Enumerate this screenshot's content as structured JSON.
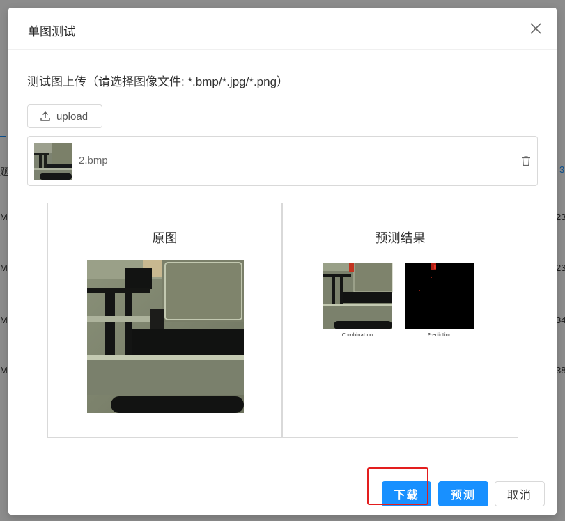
{
  "background": {
    "cells_left": [
      "题",
      "M",
      "M",
      "M",
      "M"
    ],
    "cells_right": [
      "3",
      "23",
      "23",
      "34",
      "38"
    ]
  },
  "dialog": {
    "title": "单图测试",
    "close_icon": "close-icon",
    "upload_label": "测试图上传（请选择图像文件: *.bmp/*.jpg/*.png）",
    "upload_button": "upload",
    "file": {
      "name": "2.bmp"
    },
    "original_title": "原图",
    "result_title": "预测结果",
    "result_captions": [
      "Combination",
      "Prediction"
    ],
    "footer": {
      "download": "下载",
      "predict": "预测",
      "cancel": "取消"
    }
  },
  "colors": {
    "primary": "#1890ff",
    "highlight": "#e31e1e",
    "overlay": "rgba(0,0,0,0.45)"
  }
}
